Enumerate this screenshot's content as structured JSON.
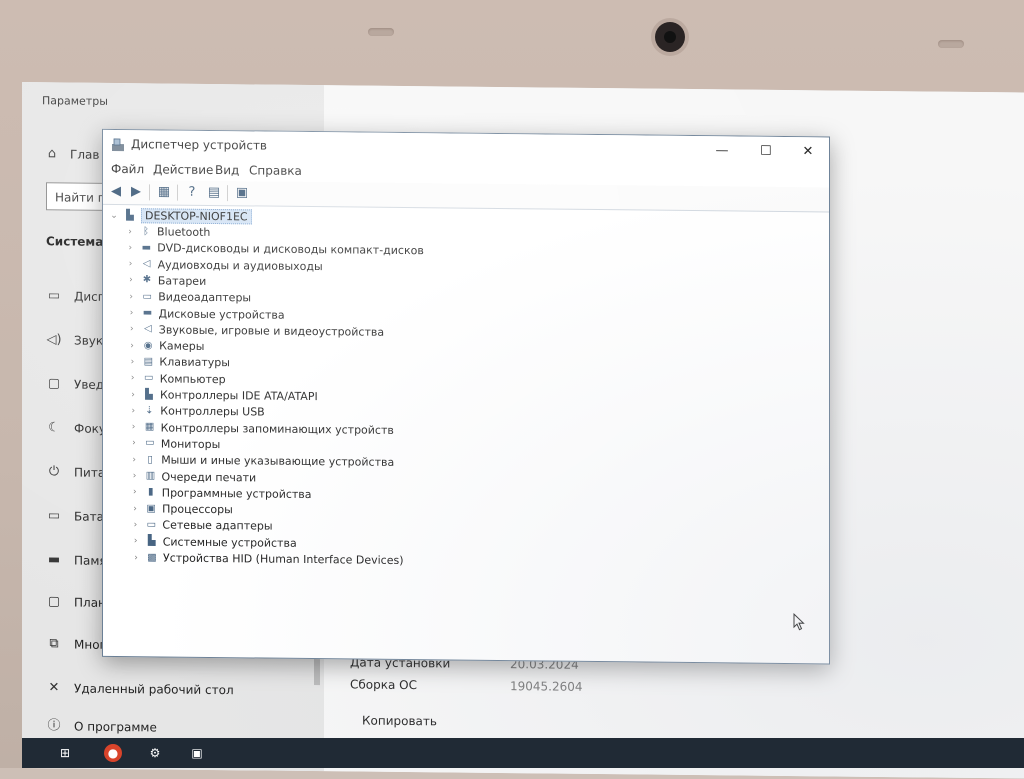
{
  "settings": {
    "window_title": "Параметры",
    "home_label": "Глав",
    "search_placeholder": "Найти п",
    "section_title": "Система",
    "nav_items": [
      {
        "label": "Дисп",
        "icon": "display-icon"
      },
      {
        "label": "Звук",
        "icon": "speaker-icon"
      },
      {
        "label": "Увед",
        "icon": "notification-icon"
      },
      {
        "label": "Фоку",
        "icon": "moon-icon"
      },
      {
        "label": "Пита",
        "icon": "power-icon"
      },
      {
        "label": "Батар",
        "icon": "battery-icon"
      },
      {
        "label": "Памя",
        "icon": "storage-icon"
      },
      {
        "label": "План",
        "icon": "tablet-icon"
      },
      {
        "label": "Много",
        "icon": "multitask-icon"
      },
      {
        "label": "Удаленный рабочий стол",
        "icon": "remote-desktop-icon"
      },
      {
        "label": "О программе",
        "icon": "info-icon"
      }
    ],
    "properties": [
      {
        "label": "Дата установки",
        "value": "20.03.2024"
      },
      {
        "label": "Сборка ОС",
        "value": "19045.2604"
      }
    ],
    "copy_label": "Копировать"
  },
  "device_manager": {
    "title": "Диспетчер устройств",
    "window_buttons": {
      "minimize": "—",
      "maximize": "☐",
      "close": "✕"
    },
    "menu": [
      "Файл",
      "Действие",
      "Вид",
      "Справка"
    ],
    "root_node": "DESKTOP-NIOF1EC",
    "categories": [
      {
        "label": "Bluetooth",
        "icon": "bluetooth-icon"
      },
      {
        "label": "DVD-дисководы и дисководы компакт-дисков",
        "icon": "dvd-drive-icon"
      },
      {
        "label": "Аудиовходы и аудиовыходы",
        "icon": "audio-io-icon"
      },
      {
        "label": "Батареи",
        "icon": "battery-icon"
      },
      {
        "label": "Видеоадаптеры",
        "icon": "display-adapter-icon"
      },
      {
        "label": "Дисковые устройства",
        "icon": "disk-drive-icon"
      },
      {
        "label": "Звуковые, игровые и видеоустройства",
        "icon": "sound-device-icon"
      },
      {
        "label": "Камеры",
        "icon": "camera-icon"
      },
      {
        "label": "Клавиатуры",
        "icon": "keyboard-icon"
      },
      {
        "label": "Компьютер",
        "icon": "computer-icon"
      },
      {
        "label": "Контроллеры IDE ATA/ATAPI",
        "icon": "ide-controller-icon"
      },
      {
        "label": "Контроллеры USB",
        "icon": "usb-controller-icon"
      },
      {
        "label": "Контроллеры запоминающих устройств",
        "icon": "storage-controller-icon"
      },
      {
        "label": "Мониторы",
        "icon": "monitor-icon"
      },
      {
        "label": "Мыши и иные указывающие устройства",
        "icon": "mouse-icon"
      },
      {
        "label": "Очереди печати",
        "icon": "printer-icon"
      },
      {
        "label": "Программные устройства",
        "icon": "software-device-icon"
      },
      {
        "label": "Процессоры",
        "icon": "processor-icon"
      },
      {
        "label": "Сетевые адаптеры",
        "icon": "network-adapter-icon"
      },
      {
        "label": "Системные устройства",
        "icon": "system-device-icon"
      },
      {
        "label": "Устройства HID (Human Interface Devices)",
        "icon": "hid-icon"
      }
    ]
  },
  "colors": {
    "selection": "#cfe0f3",
    "taskbar": "#202a35"
  }
}
